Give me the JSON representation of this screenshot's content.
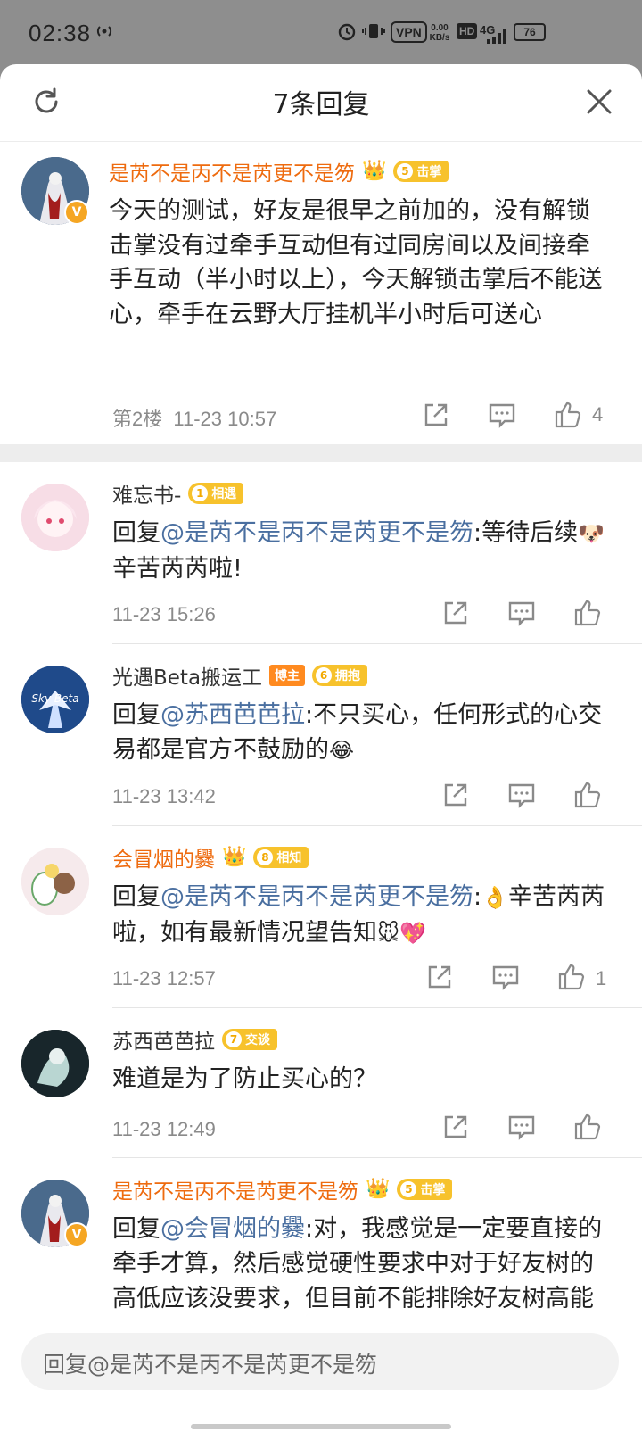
{
  "status_bar": {
    "time": "02:38",
    "vpn": "VPN",
    "speed_value": "0.00",
    "speed_unit": "KB/s",
    "hd": "HD",
    "network": "4G",
    "battery": "76"
  },
  "header": {
    "title": "7条回复",
    "refresh_icon": "refresh-icon",
    "close_icon": "close-icon"
  },
  "main_comment": {
    "author": "是芮不是丙不是芮更不是笏",
    "level": "5",
    "level_label": "击掌",
    "text": "今天的测试，好友是很早之前加的，没有解锁击掌没有过牵手互动但有过同房间以及间接牵手互动（半小时以上），今天解锁击掌后不能送心，牵手在云野大厅挂机半小时后可送心",
    "floor": "第2楼",
    "time": "11-23 10:57",
    "likes": "4",
    "verified_mark": "V"
  },
  "replies": [
    {
      "author": "难忘书-",
      "level": "1",
      "level_label": "相遇",
      "prefix": "回复",
      "mention": "@是芮不是丙不是芮更不是笏",
      "text_a": ":等待后续",
      "emoji": "🐶",
      "text_b": "辛苦芮芮啦!",
      "time": "11-23 15:26",
      "likes": ""
    },
    {
      "author": "光遇Beta搬运工",
      "tag": "博主",
      "level": "6",
      "level_label": "拥抱",
      "prefix": "回复",
      "mention": "@苏西芭芭拉",
      "text_a": ":不只买心，任何形式的心交易都是官方不鼓励的",
      "emoji": "😂",
      "text_b": "",
      "time": "11-23 13:42",
      "likes": "",
      "avatar_text": "Sky Beta"
    },
    {
      "author": "会冒烟的爨",
      "level": "8",
      "level_label": "相知",
      "prefix": "回复",
      "mention": "@是芮不是丙不是芮更不是笏",
      "text_a": ":",
      "emoji": "👌",
      "text_b": "辛苦芮芮啦，如有最新情况望告知",
      "emoji2": "🐭💖",
      "time": "11-23 12:57",
      "likes": "1"
    },
    {
      "author": "苏西芭芭拉",
      "level": "7",
      "level_label": "交谈",
      "text": "难道是为了防止买心的？",
      "time": "11-23 12:49",
      "likes": ""
    },
    {
      "author": "是芮不是丙不是芮更不是笏",
      "level": "5",
      "level_label": "击掌",
      "prefix": "回复",
      "mention": "@会冒烟的爨",
      "text_a": ":对，我感觉是一定要直接的牵手才算，然后感觉硬性要求中对于好友树的高低应该没要求，但目前不能排除好友树高能降低其他条件的可能是（有"
    }
  ],
  "reply_bar": {
    "placeholder": "回复@是芮不是丙不是芮更不是笏"
  },
  "colors": {
    "accent_orange": "#ee6b0f",
    "mention_blue": "#4a6fa0",
    "badge_yellow": "#f7c22c"
  }
}
